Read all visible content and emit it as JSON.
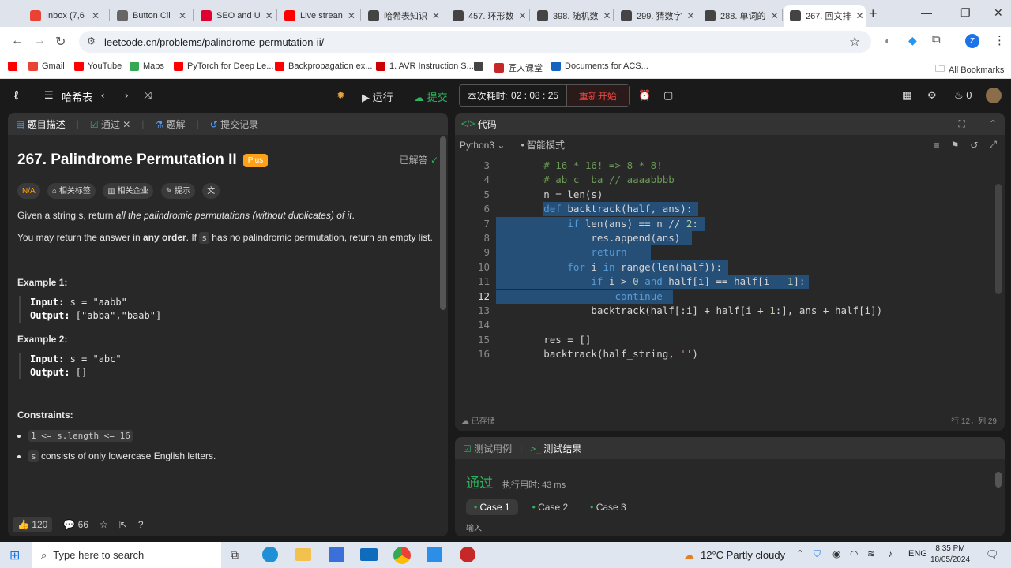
{
  "browser": {
    "tabs": [
      {
        "label": "Inbox (7,6",
        "icon": "gmail-icon",
        "color": "#ea4335"
      },
      {
        "label": "Button Cli",
        "icon": "globe-icon",
        "color": "#666666"
      },
      {
        "label": "SEO and U",
        "icon": "angular-icon",
        "color": "#dd0031"
      },
      {
        "label": "Live strean",
        "icon": "youtube-icon",
        "color": "#ff0000"
      },
      {
        "label": "哈希表知识",
        "icon": "leetcode-icon",
        "color": "#444444"
      },
      {
        "label": "457. 环形数",
        "icon": "leetcode-icon",
        "color": "#444444"
      },
      {
        "label": "398. 随机数",
        "icon": "leetcode-icon",
        "color": "#444444"
      },
      {
        "label": "299. 猜数字",
        "icon": "leetcode-icon",
        "color": "#444444"
      },
      {
        "label": "288. 单词的",
        "icon": "leetcode-icon",
        "color": "#444444"
      },
      {
        "label": "267. 回文排",
        "icon": "leetcode-icon",
        "color": "#444444"
      }
    ],
    "url": "leetcode.cn/problems/palindrome-permutation-ii/",
    "bookmarks": [
      {
        "label": "",
        "color": "#ff0000"
      },
      {
        "label": "Gmail",
        "color": "#ea4335"
      },
      {
        "label": "YouTube",
        "color": "#ff0000"
      },
      {
        "label": "Maps",
        "color": "#34a853"
      },
      {
        "label": "PyTorch for Deep Le...",
        "color": "#ff0000"
      },
      {
        "label": "Backpropagation ex...",
        "color": "#ff0000"
      },
      {
        "label": "1. AVR Instruction S...",
        "color": "#cc0000"
      },
      {
        "label": "",
        "color": "#444444"
      },
      {
        "label": "匠人课堂",
        "color": "#c62828"
      },
      {
        "label": "Documents for ACS...",
        "color": "#1565c0"
      }
    ],
    "all_bookmarks": "All Bookmarks",
    "profile_initial": "Z"
  },
  "lc": {
    "nav_title": "哈希表",
    "run": "运行",
    "submit": "提交",
    "timer_label": "本次耗时:",
    "timer": "02 : 08 : 25",
    "restart": "重新开始",
    "flame_count": "0"
  },
  "problem": {
    "tabs": [
      "题目描述",
      "通过",
      "题解",
      "提交记录"
    ],
    "title": "267. Palindrome Permutation II",
    "plus": "Plus",
    "solved": "已解答",
    "difficulty": "N/A",
    "chips": [
      "相关标签",
      "相关企业",
      "提示"
    ],
    "desc1_pre": "Given a string s, return ",
    "desc1_em": "all the palindromic permutations (without duplicates) of it",
    "desc1_post": ".",
    "desc2_pre": "You may return the answer in ",
    "desc2_b": "any order",
    "desc2_mid": ". If ",
    "desc2_code": "s",
    "desc2_post": " has no palindromic permutation, return an empty list.",
    "ex1_title": "Example 1:",
    "ex1_input_label": "Input:",
    "ex1_input": " s = \"aabb\"",
    "ex1_output_label": "Output:",
    "ex1_output": " [\"abba\",\"baab\"]",
    "ex2_title": "Example 2:",
    "ex2_input_label": "Input:",
    "ex2_input": " s = \"abc\"",
    "ex2_output_label": "Output:",
    "ex2_output": " []",
    "constraints_title": "Constraints:",
    "c1": "1 <= s.length <= 16",
    "c2_code": "s",
    "c2": " consists of only lowercase English letters.",
    "likes": "120",
    "comments": "66"
  },
  "editor": {
    "header": "代码",
    "language": "Python3",
    "mode": "智能模式",
    "saved": "已存储",
    "cursor": "行 12，列 29",
    "lines": [
      {
        "n": "3",
        "text": "        # 16 * 16! => 8 * 8!"
      },
      {
        "n": "4",
        "text": "        # ab c  ba // aaaabbbb"
      },
      {
        "n": "5",
        "text": "        n = len(s)"
      },
      {
        "n": "6",
        "text": "        def backtrack(half, ans):"
      },
      {
        "n": "7",
        "text": "            if len(ans) == n // 2:"
      },
      {
        "n": "8",
        "text": "                res.append(ans)"
      },
      {
        "n": "9",
        "text": "                return"
      },
      {
        "n": "10",
        "text": "            for i in range(len(half)):"
      },
      {
        "n": "11",
        "text": "                if i > 0 and half[i] == half[i - 1]:"
      },
      {
        "n": "12",
        "text": "                    continue"
      },
      {
        "n": "13",
        "text": "                backtrack(half[:i] + half[i + 1:], ans + half[i])"
      },
      {
        "n": "14",
        "text": ""
      },
      {
        "n": "15",
        "text": "        res = []"
      },
      {
        "n": "16",
        "text": "        backtrack(half_string, '')"
      }
    ]
  },
  "results": {
    "tab1": "测试用例",
    "tab2": "测试结果",
    "status": "通过",
    "runtime": "执行用时: 43 ms",
    "cases": [
      "Case 1",
      "Case 2",
      "Case 3"
    ],
    "input_label": "输入"
  },
  "taskbar": {
    "search": "Type here to search",
    "weather": "12°C  Partly cloudy",
    "lang": "ENG",
    "time": "8:35 PM",
    "date": "18/05/2024"
  }
}
